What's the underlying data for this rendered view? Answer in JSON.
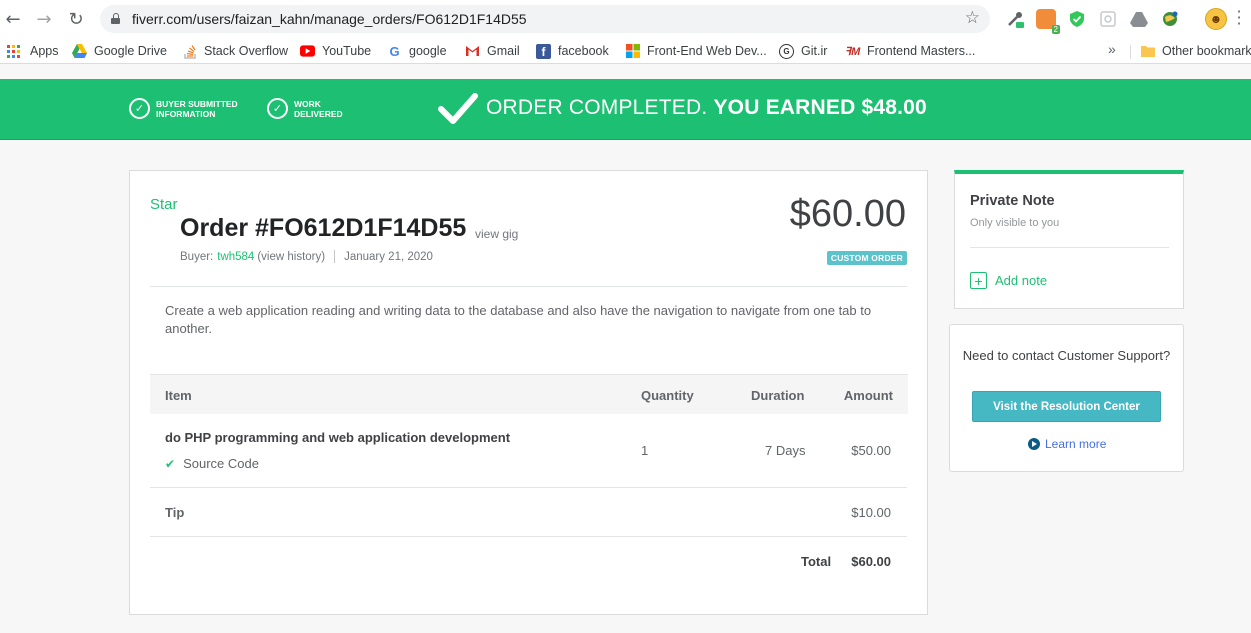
{
  "browser": {
    "url": "fiverr.com/users/faizan_kahn/manage_orders/FO612D1F14D55",
    "ext_badge_1": "2",
    "bookmarks": [
      {
        "label": "Apps",
        "icon": "apps-grid-icon"
      },
      {
        "label": "Google Drive",
        "icon": "google-drive-icon"
      },
      {
        "label": "Stack Overflow",
        "icon": "stack-overflow-icon"
      },
      {
        "label": "YouTube",
        "icon": "youtube-icon"
      },
      {
        "label": "google",
        "icon": "google-icon"
      },
      {
        "label": "Gmail",
        "icon": "gmail-icon"
      },
      {
        "label": "facebook",
        "icon": "facebook-icon"
      },
      {
        "label": "Front-End Web Dev...",
        "icon": "microsoft-icon"
      },
      {
        "label": "Git.ir",
        "icon": "gitir-icon"
      },
      {
        "label": "Frontend Masters...",
        "icon": "frontend-masters-icon"
      }
    ],
    "more_bookmarks": "»",
    "other_bookmarks": "Other bookmarks"
  },
  "banner": {
    "step1": "Buyer submitted information",
    "step2": "Work delivered",
    "message": "ORDER COMPLETED.",
    "earned": "YOU EARNED $48.00",
    "color": "#1dbf73"
  },
  "order": {
    "star": "Star",
    "title": "Order #FO612D1F14D55",
    "view_gig": "view gig",
    "buyer_prefix": "Buyer:",
    "buyer_name": "twh584",
    "view_history": "(view history)",
    "date": "January 21, 2020",
    "price": "$60.00",
    "badge": "CUSTOM ORDER",
    "description": "Create a web application reading and writing data to the database and also have the navigation to navigate from one tab to another.",
    "table": {
      "headers": {
        "item": "Item",
        "quantity": "Quantity",
        "duration": "Duration",
        "amount": "Amount"
      },
      "row": {
        "item": "do PHP programming and web application development",
        "feature": "Source Code",
        "quantity": "1",
        "duration": "7 Days",
        "amount": "$50.00"
      },
      "tip_label": "Tip",
      "tip_amount": "$10.00",
      "total_label": "Total",
      "total_amount": "$60.00"
    }
  },
  "note": {
    "title": "Private Note",
    "subtitle": "Only visible to you",
    "add_label": "Add note"
  },
  "support": {
    "question": "Need to contact Customer Support?",
    "button": "Visit the Resolution Center",
    "learn_more": "Learn more"
  }
}
